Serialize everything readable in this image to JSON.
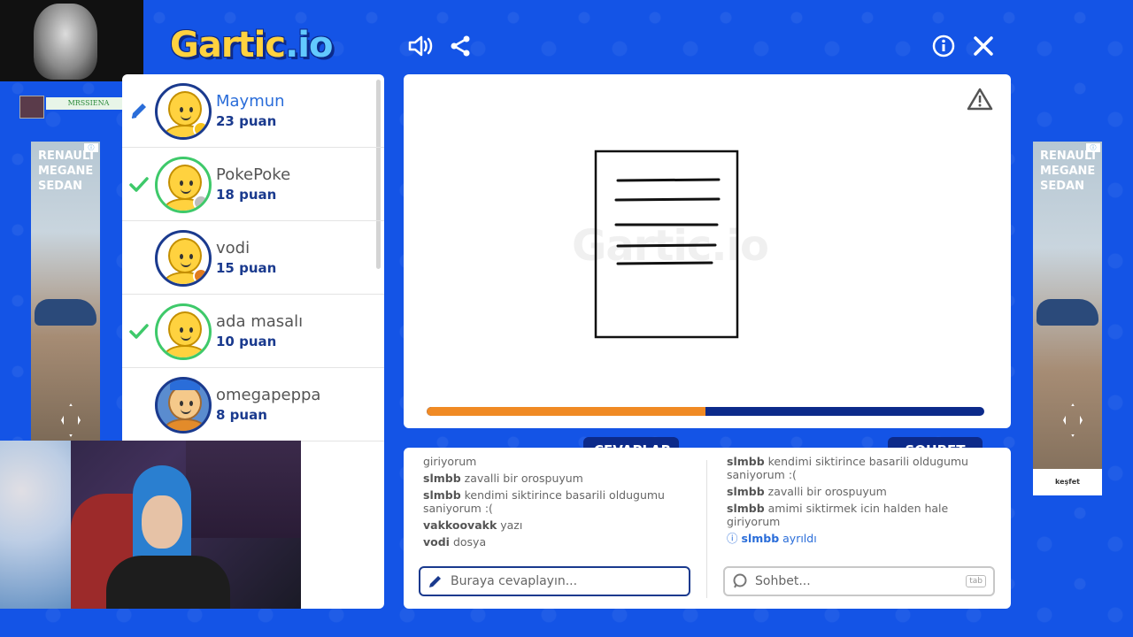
{
  "header": {
    "logo_main": "Gartic",
    "logo_suffix": ".io"
  },
  "stream": {
    "tag_name": "MRSSIENA"
  },
  "players": [
    {
      "name": "Maymun",
      "points": "23 puan",
      "status": "drawing",
      "badge_color": "#f5c21a",
      "active": true
    },
    {
      "name": "PokePoke",
      "points": "18 puan",
      "status": "guessed",
      "badge_color": "#bdbdbd",
      "active": false
    },
    {
      "name": "vodi",
      "points": "15 puan",
      "status": "none",
      "badge_color": "#e07b1e",
      "active": false
    },
    {
      "name": "ada masalı",
      "points": "10 puan",
      "status": "guessed",
      "badge_color": null,
      "active": false
    },
    {
      "name": "omegapeppa",
      "points": "8 puan",
      "status": "none",
      "badge_color": null,
      "active": false
    }
  ],
  "ads": {
    "text_line1": "RENAULT",
    "text_line2": "MEGANE",
    "text_line3": "SEDAN",
    "cta": "keşfet"
  },
  "canvas": {
    "watermark": "Gartic.io",
    "timer_progress": 0.5
  },
  "tabs": {
    "answers": "CEVAPLAR",
    "chat": "SOHBET"
  },
  "answers": {
    "messages": [
      {
        "user": "",
        "text": "giriyorum"
      },
      {
        "user": "slmbb",
        "text": "zavalli bir orospuyum"
      },
      {
        "user": "slmbb",
        "text": "kendimi siktirince basarili oldugumu saniyorum :("
      },
      {
        "user": "vakkoovakk",
        "text": "yazı"
      },
      {
        "user": "vodi",
        "text": "dosya"
      }
    ],
    "placeholder": "Buraya cevaplayın..."
  },
  "chat": {
    "messages": [
      {
        "user": "slmbb",
        "text": "kendimi siktirince basarili oldugumu saniyorum :("
      },
      {
        "user": "slmbb",
        "text": "zavalli bir orospuyum"
      },
      {
        "user": "slmbb",
        "text": "amimi siktirmek icin halden hale giriyorum"
      }
    ],
    "system": {
      "user": "slmbb",
      "text": "ayrıldı"
    },
    "placeholder": "Sohbet...",
    "tab_hint": "tab"
  },
  "colors": {
    "background": "#1454e6",
    "accent": "#0c2a8a",
    "timer_fill": "#f08a24",
    "active_name": "#2a6dd9",
    "check": "#3ec96a"
  }
}
